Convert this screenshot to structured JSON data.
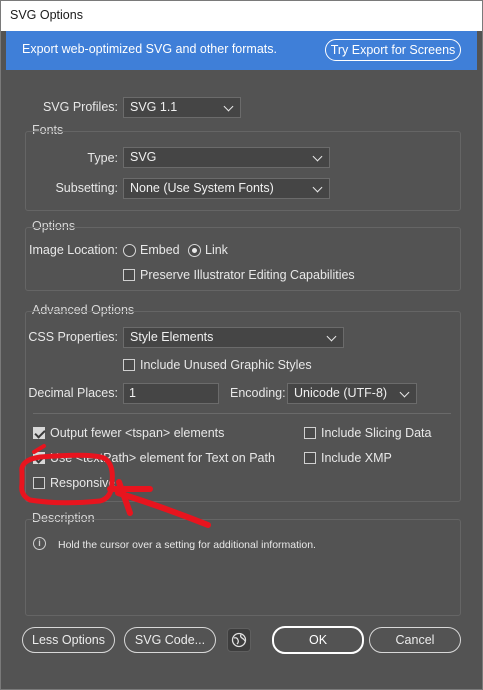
{
  "window": {
    "title": "SVG Options"
  },
  "banner": {
    "text": "Export web-optimized SVG and other formats.",
    "button_label": "Try Export for Screens"
  },
  "svg_profiles": {
    "label": "SVG Profiles:",
    "value": "SVG 1.1"
  },
  "fonts": {
    "title": "Fonts",
    "type_label": "Type:",
    "type_value": "SVG",
    "subsetting_label": "Subsetting:",
    "subsetting_value": "None (Use System Fonts)"
  },
  "options": {
    "title": "Options",
    "image_location_label": "Image Location:",
    "embed_label": "Embed",
    "link_label": "Link",
    "selected": "Link",
    "preserve_label": "Preserve Illustrator Editing Capabilities",
    "preserve_checked": false
  },
  "advanced": {
    "title": "Advanced Options",
    "css_label": "CSS Properties:",
    "css_value": "Style Elements",
    "include_unused_label": "Include Unused Graphic Styles",
    "include_unused_checked": false,
    "decimal_label": "Decimal Places:",
    "decimal_value": "1",
    "encoding_label": "Encoding:",
    "encoding_value": "Unicode (UTF-8)",
    "output_fewer_label": "Output fewer <tspan> elements",
    "output_fewer_checked": true,
    "textpath_label": "Use <textPath> element for Text on Path",
    "textpath_checked": true,
    "slicing_label": "Include Slicing Data",
    "slicing_checked": false,
    "xmp_label": "Include XMP",
    "xmp_checked": false,
    "responsive_label": "Responsive",
    "responsive_checked": false
  },
  "description": {
    "title": "Description",
    "text": "Hold the cursor over a setting for additional information."
  },
  "footer": {
    "less_options": "Less Options",
    "svg_code": "SVG Code...",
    "ok": "OK",
    "cancel": "Cancel"
  },
  "colors": {
    "banner": "#3f7fd8",
    "dialog_bg": "#535353",
    "annotation": "#e8141e"
  }
}
